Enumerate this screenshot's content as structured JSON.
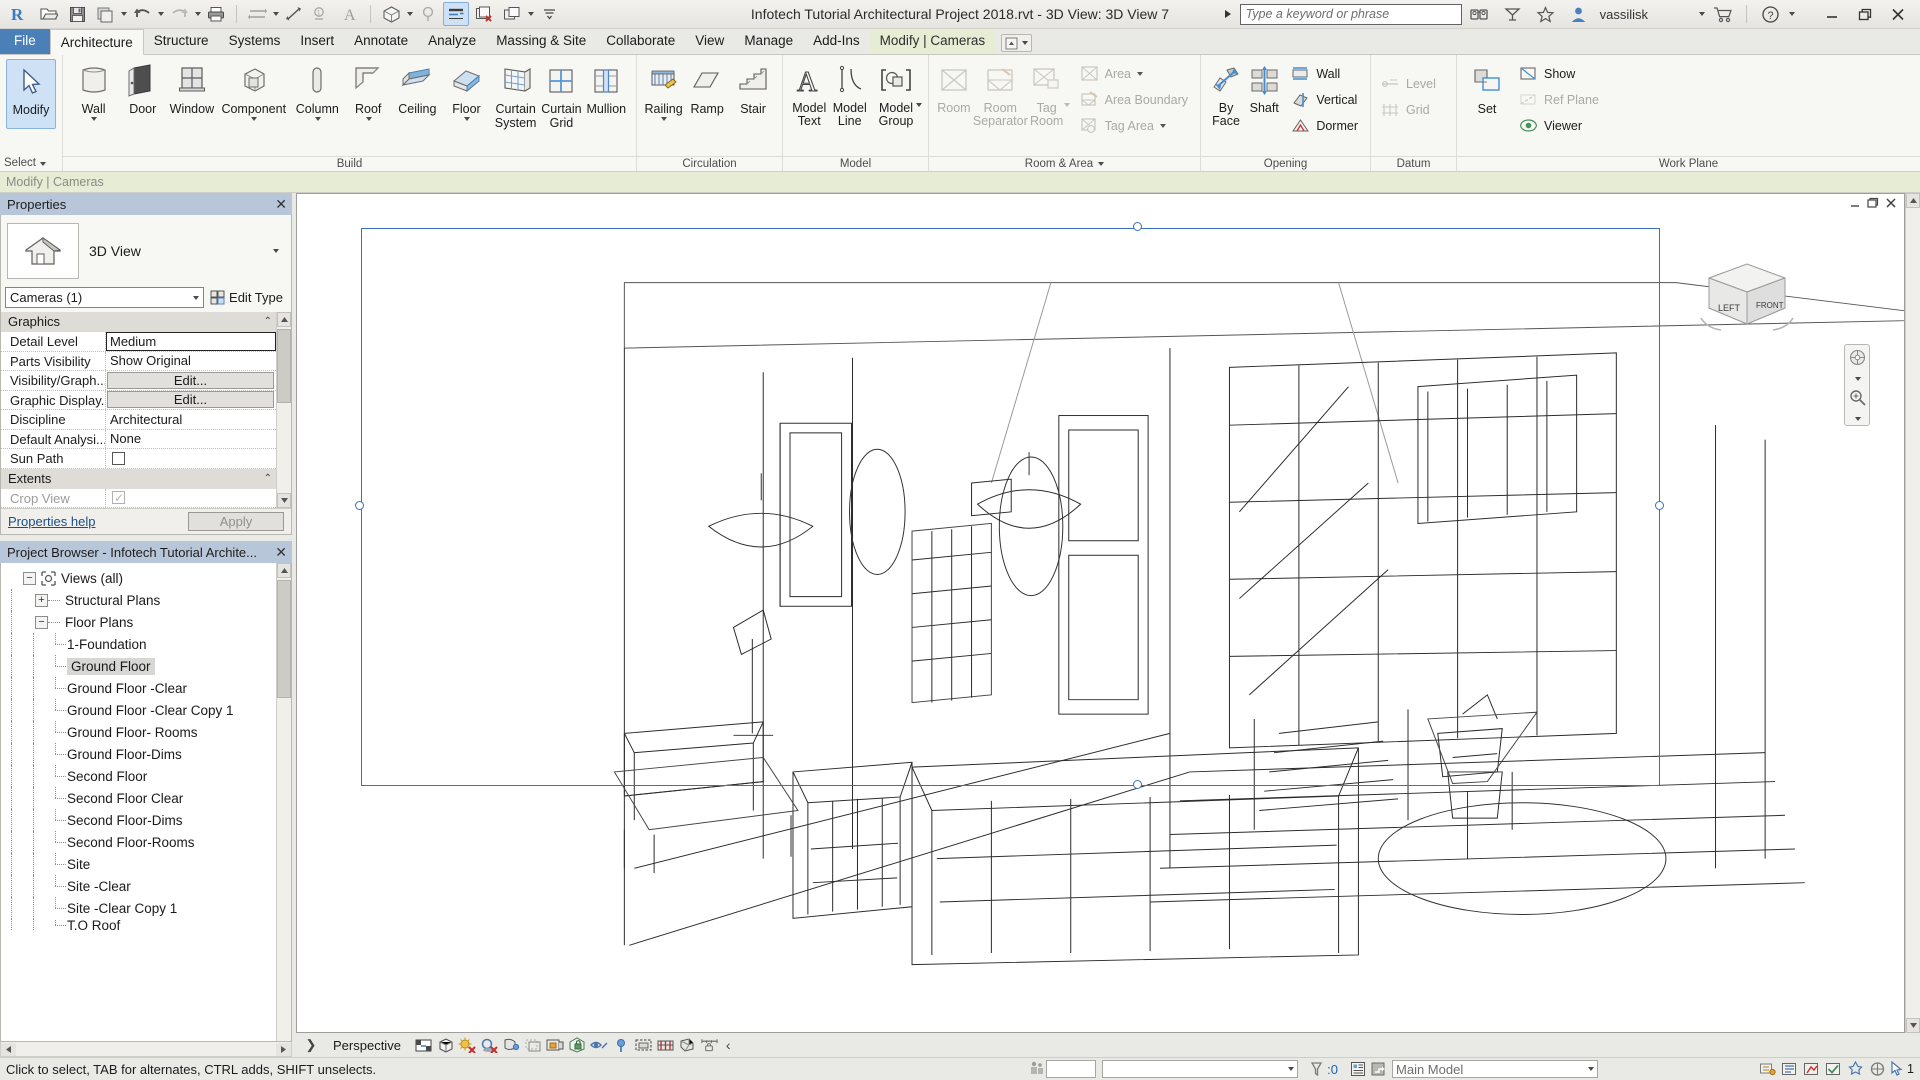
{
  "titlebar": {
    "app_title": "Infotech Tutorial Architectural Project 2018.rvt - 3D View: 3D View 7",
    "search_placeholder": "Type a keyword or phrase",
    "user_name": "vassilisk",
    "quick_access": [
      {
        "name": "revit-logo",
        "label": "R"
      },
      {
        "name": "open-icon",
        "label": "Open"
      },
      {
        "name": "save-icon",
        "label": "Save"
      },
      {
        "name": "save-as-icon",
        "label": "Save As"
      },
      {
        "name": "undo-icon",
        "label": "Undo"
      },
      {
        "name": "redo-icon",
        "label": "Redo"
      },
      {
        "name": "print-icon",
        "label": "Print"
      },
      {
        "name": "measure-icon",
        "label": "Measure"
      },
      {
        "name": "aligned-dimension-icon",
        "label": "Aligned Dimension"
      },
      {
        "name": "tag-icon",
        "label": "Tag by Category"
      },
      {
        "name": "text-icon",
        "label": "Text"
      },
      {
        "name": "default-3d-view-icon",
        "label": "Default 3D View"
      },
      {
        "name": "section-icon",
        "label": "Section"
      },
      {
        "name": "thin-lines-icon",
        "label": "Thin Lines"
      },
      {
        "name": "close-hidden-windows-icon",
        "label": "Close Hidden Windows"
      },
      {
        "name": "switch-windows-icon",
        "label": "Switch Windows"
      }
    ],
    "window_controls": {
      "minimize": "_",
      "restore": "Restore",
      "close": "×"
    }
  },
  "tabs": [
    {
      "label": "File",
      "state": "file"
    },
    {
      "label": "Architecture",
      "state": "selected"
    },
    {
      "label": "Structure",
      "state": "normal"
    },
    {
      "label": "Systems",
      "state": "normal"
    },
    {
      "label": "Insert",
      "state": "normal"
    },
    {
      "label": "Annotate",
      "state": "normal"
    },
    {
      "label": "Analyze",
      "state": "normal"
    },
    {
      "label": "Massing & Site",
      "state": "normal"
    },
    {
      "label": "Collaborate",
      "state": "normal"
    },
    {
      "label": "View",
      "state": "normal"
    },
    {
      "label": "Manage",
      "state": "normal"
    },
    {
      "label": "Add-Ins",
      "state": "normal"
    },
    {
      "label": "Modify | Cameras",
      "state": "contextual"
    }
  ],
  "ribbon": {
    "select_panel": {
      "button": "Modify",
      "title": "Select"
    },
    "panels": [
      {
        "title": "Build",
        "buttons": [
          {
            "label": "Wall",
            "icon": "wall-icon",
            "dropdown": true,
            "disabled": false
          },
          {
            "label": "Door",
            "icon": "door-icon",
            "dropdown": false,
            "disabled": false
          },
          {
            "label": "Window",
            "icon": "window-icon",
            "dropdown": false,
            "disabled": false
          },
          {
            "label": "Component",
            "icon": "component-icon",
            "dropdown": true,
            "disabled": false
          },
          {
            "label": "Column",
            "icon": "column-icon",
            "dropdown": true,
            "disabled": false
          },
          {
            "label": "Roof",
            "icon": "roof-icon",
            "dropdown": true,
            "disabled": false
          },
          {
            "label": "Ceiling",
            "icon": "ceiling-icon",
            "dropdown": false,
            "disabled": false
          },
          {
            "label": "Floor",
            "icon": "floor-icon",
            "dropdown": true,
            "disabled": false
          },
          {
            "label": "Curtain System",
            "icon": "curtain-system-icon",
            "dropdown": false,
            "disabled": false
          },
          {
            "label": "Curtain Grid",
            "icon": "curtain-grid-icon",
            "dropdown": false,
            "disabled": false
          },
          {
            "label": "Mullion",
            "icon": "mullion-icon",
            "dropdown": false,
            "disabled": false
          }
        ]
      },
      {
        "title": "Circulation",
        "buttons": [
          {
            "label": "Railing",
            "icon": "railing-icon",
            "dropdown": true,
            "disabled": false
          },
          {
            "label": "Ramp",
            "icon": "ramp-icon",
            "dropdown": false,
            "disabled": false
          },
          {
            "label": "Stair",
            "icon": "stair-icon",
            "dropdown": false,
            "disabled": false
          }
        ]
      },
      {
        "title": "Model",
        "buttons": [
          {
            "label": "Model Text",
            "icon": "model-text-icon",
            "dropdown": false,
            "disabled": false
          },
          {
            "label": "Model Line",
            "icon": "model-line-icon",
            "dropdown": false,
            "disabled": false
          },
          {
            "label": "Model Group",
            "icon": "model-group-icon",
            "dropdown": true,
            "disabled": false
          }
        ]
      },
      {
        "title": "Room & Area",
        "title_dropdown": true,
        "buttons": [
          {
            "label": "Room",
            "icon": "room-icon",
            "dropdown": false,
            "disabled": true
          },
          {
            "label": "Room Separator",
            "icon": "room-separator-icon",
            "dropdown": false,
            "disabled": true
          },
          {
            "label": "Tag Room",
            "icon": "tag-room-icon",
            "dropdown": true,
            "disabled": true
          }
        ],
        "small_buttons": [
          {
            "label": "Area",
            "icon": "area-icon",
            "dropdown": true,
            "disabled": true
          },
          {
            "label": "Area Boundary",
            "icon": "area-boundary-icon",
            "dropdown": false,
            "disabled": true
          },
          {
            "label": "Tag Area",
            "icon": "tag-area-icon",
            "dropdown": true,
            "disabled": true
          }
        ]
      },
      {
        "title": "Opening",
        "buttons": [
          {
            "label": "By Face",
            "icon": "by-face-icon",
            "dropdown": false,
            "disabled": false
          },
          {
            "label": "Shaft",
            "icon": "shaft-icon",
            "dropdown": false,
            "disabled": false
          }
        ],
        "small_buttons": [
          {
            "label": "Wall",
            "icon": "wall-opening-icon",
            "dropdown": false,
            "disabled": false
          },
          {
            "label": "Vertical",
            "icon": "vertical-opening-icon",
            "dropdown": false,
            "disabled": false
          },
          {
            "label": "Dormer",
            "icon": "dormer-opening-icon",
            "dropdown": false,
            "disabled": false
          }
        ]
      },
      {
        "title": "Datum",
        "small_buttons": [
          {
            "label": "Level",
            "icon": "level-icon",
            "dropdown": false,
            "disabled": true
          },
          {
            "label": "Grid",
            "icon": "grid-icon",
            "dropdown": false,
            "disabled": true
          }
        ]
      },
      {
        "title": "Work Plane",
        "buttons": [
          {
            "label": "Set",
            "icon": "set-workplane-icon",
            "dropdown": false,
            "disabled": false
          }
        ],
        "small_buttons": [
          {
            "label": "Show",
            "icon": "show-workplane-icon",
            "dropdown": false,
            "disabled": false
          },
          {
            "label": "Ref Plane",
            "icon": "ref-plane-icon",
            "dropdown": false,
            "disabled": true
          },
          {
            "label": "Viewer",
            "icon": "viewer-icon",
            "dropdown": false,
            "disabled": false
          }
        ]
      }
    ]
  },
  "options_bar": {
    "text": "Modify | Cameras"
  },
  "properties": {
    "panel_title": "Properties",
    "type_name": "3D View",
    "type_icon": "house-3d-view-icon",
    "selector_value": "Cameras (1)",
    "edit_type_label": "Edit Type",
    "groups": [
      {
        "name": "Graphics",
        "rows": [
          {
            "key": "Detail Level",
            "value": "Medium",
            "kind": "boxed"
          },
          {
            "key": "Parts Visibility",
            "value": "Show Original",
            "kind": "text"
          },
          {
            "key": "Visibility/Graph...",
            "value": "Edit...",
            "kind": "button"
          },
          {
            "key": "Graphic Display...",
            "value": "Edit...",
            "kind": "button"
          },
          {
            "key": "Discipline",
            "value": "Architectural",
            "kind": "text"
          },
          {
            "key": "Default Analysi...",
            "value": "None",
            "kind": "text"
          },
          {
            "key": "Sun Path",
            "value": "",
            "kind": "checkbox"
          }
        ]
      },
      {
        "name": "Extents",
        "rows": [
          {
            "key": "Crop View",
            "value": "",
            "kind": "checkbox-disabled",
            "disabled": true
          }
        ]
      }
    ],
    "help_link": "Properties help",
    "apply_button": "Apply"
  },
  "project_browser": {
    "panel_title": "Project Browser - Infotech Tutorial Archite...",
    "nodes": [
      {
        "label": "Views (all)",
        "depth": 0,
        "expander": "−",
        "icon": "views-icon",
        "selected": false
      },
      {
        "label": "Structural Plans",
        "depth": 1,
        "expander": "+",
        "selected": false
      },
      {
        "label": "Floor Plans",
        "depth": 1,
        "expander": "−",
        "selected": false
      },
      {
        "label": "1-Foundation",
        "depth": 2,
        "expander": "",
        "selected": false
      },
      {
        "label": "Ground Floor",
        "depth": 2,
        "expander": "",
        "selected": true
      },
      {
        "label": "Ground Floor -Clear",
        "depth": 2,
        "expander": "",
        "selected": false
      },
      {
        "label": "Ground Floor -Clear Copy 1",
        "depth": 2,
        "expander": "",
        "selected": false
      },
      {
        "label": "Ground Floor- Rooms",
        "depth": 2,
        "expander": "",
        "selected": false
      },
      {
        "label": "Ground Floor-Dims",
        "depth": 2,
        "expander": "",
        "selected": false
      },
      {
        "label": "Second Floor",
        "depth": 2,
        "expander": "",
        "selected": false
      },
      {
        "label": "Second Floor Clear",
        "depth": 2,
        "expander": "",
        "selected": false
      },
      {
        "label": "Second Floor-Dims",
        "depth": 2,
        "expander": "",
        "selected": false
      },
      {
        "label": "Second Floor-Rooms",
        "depth": 2,
        "expander": "",
        "selected": false
      },
      {
        "label": "Site",
        "depth": 2,
        "expander": "",
        "selected": false
      },
      {
        "label": "Site -Clear",
        "depth": 2,
        "expander": "",
        "selected": false
      },
      {
        "label": "Site -Clear Copy 1",
        "depth": 2,
        "expander": "",
        "selected": false
      },
      {
        "label": "T.O Roof",
        "depth": 2,
        "expander": "",
        "selected": false
      }
    ]
  },
  "view_control_bar": {
    "scale_label": "Perspective",
    "icons": [
      {
        "name": "detail-level-icon"
      },
      {
        "name": "visual-style-icon"
      },
      {
        "name": "sun-path-off-icon"
      },
      {
        "name": "shadows-off-icon"
      },
      {
        "name": "render-dialog-icon"
      },
      {
        "name": "crop-region-icon"
      },
      {
        "name": "show-crop-region-icon"
      },
      {
        "name": "lock-3d-view-icon"
      },
      {
        "name": "temporary-hide-isolate-icon"
      },
      {
        "name": "reveal-hidden-elements-icon"
      },
      {
        "name": "temporary-view-properties-icon"
      },
      {
        "name": "analytical-model-icon"
      },
      {
        "name": "constraints-icon"
      },
      {
        "name": "measurement-icon"
      }
    ],
    "expand_arrow": "‹"
  },
  "status_bar": {
    "message": "Click to select, TAB for alternates, CTRL adds, SHIFT unselects.",
    "filter_count": ":0",
    "workset_value": "Main Model",
    "design_option_value": "",
    "right_icons": [
      {
        "name": "model-updates-icon"
      },
      {
        "name": "worksets-icon"
      },
      {
        "name": "design-options-icon"
      },
      {
        "name": "editing-requests-icon"
      },
      {
        "name": "filter-icon"
      },
      {
        "name": "exclude-options-icon"
      },
      {
        "name": "select-links-icon"
      },
      {
        "name": "selection-count-icon"
      }
    ],
    "selection_badge": "1"
  },
  "viewcube": {
    "left_face": "LEFT",
    "front_face": "FRONT"
  },
  "canvas": {
    "view_title": "3D View 7",
    "selection_color": "#3a6fbe",
    "window_buttons": [
      "minimize",
      "restore",
      "close"
    ]
  }
}
